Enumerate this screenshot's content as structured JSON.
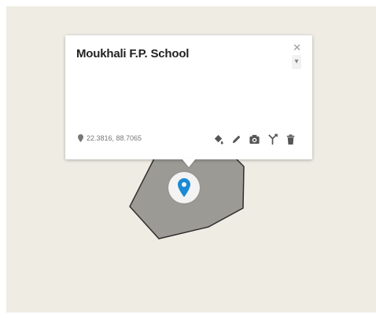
{
  "popup": {
    "title": "Moukhali F.P. School",
    "coordinates": "22.3816, 88.7065",
    "tools": [
      {
        "name": "fill-style-icon"
      },
      {
        "name": "edit-icon"
      },
      {
        "name": "camera-icon"
      },
      {
        "name": "directions-icon"
      },
      {
        "name": "delete-icon"
      }
    ]
  },
  "colors": {
    "map_background": "#efece4",
    "polygon_fill": "#9c9a94",
    "polygon_stroke": "#2f2f2f",
    "marker_blue": "#1a8ad4",
    "icon_gray": "#555555"
  }
}
